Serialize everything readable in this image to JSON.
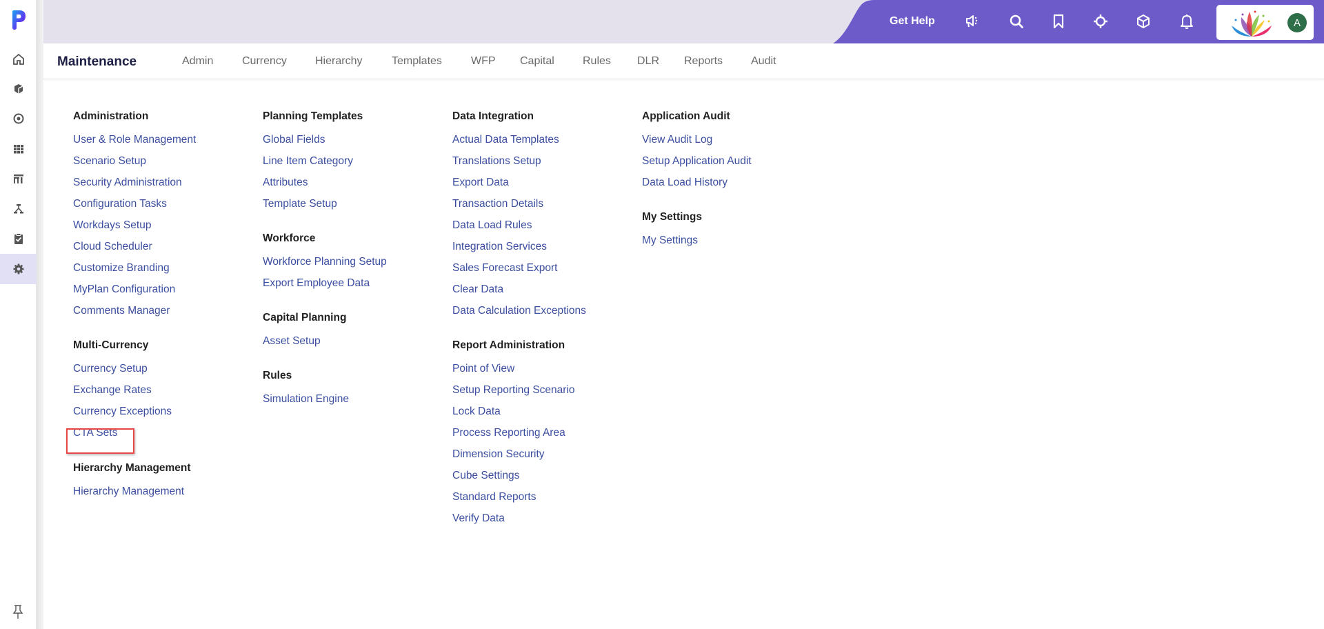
{
  "sidebar": {
    "logo": "planful-logo",
    "items": [
      {
        "name": "home",
        "icon": "home-icon",
        "active": false
      },
      {
        "name": "models",
        "icon": "cube-icon",
        "active": false
      },
      {
        "name": "dashboards",
        "icon": "target-icon",
        "active": false
      },
      {
        "name": "planning",
        "icon": "grid-icon",
        "active": false
      },
      {
        "name": "reports",
        "icon": "chart-icon",
        "active": false
      },
      {
        "name": "structure",
        "icon": "hierarchy-icon",
        "active": false
      },
      {
        "name": "tasks",
        "icon": "clipboard-check-icon",
        "active": false
      },
      {
        "name": "maintenance",
        "icon": "gear-icon",
        "active": true
      }
    ],
    "pin_icon": "pin-icon"
  },
  "topbar": {
    "get_help": "Get Help",
    "icons": [
      "megaphone-icon",
      "search-icon",
      "bookmark-icon",
      "crosshair-icon",
      "box-icon",
      "bell-icon"
    ],
    "avatar_initial": "A",
    "accent": "#6e5bca"
  },
  "menubar": {
    "title": "Maintenance",
    "tabs": [
      "Admin",
      "Currency",
      "Hierarchy",
      "Templates",
      "WFP",
      "Capital",
      "Rules",
      "DLR",
      "Reports",
      "Audit"
    ]
  },
  "columns": [
    {
      "sections": [
        {
          "title": "Administration",
          "links": [
            "User & Role Management",
            "Scenario Setup",
            "Security Administration",
            "Configuration Tasks",
            "Workdays Setup",
            "Cloud Scheduler",
            "Customize Branding",
            "MyPlan Configuration",
            "Comments Manager"
          ]
        },
        {
          "title": "Multi-Currency",
          "links": [
            "Currency Setup",
            "Exchange Rates",
            "Currency Exceptions",
            "CTA Sets"
          ]
        },
        {
          "title": "Hierarchy Management",
          "links": [
            "Hierarchy Management"
          ]
        }
      ]
    },
    {
      "sections": [
        {
          "title": "Planning Templates",
          "links": [
            "Global Fields",
            "Line Item Category",
            "Attributes",
            "Template Setup"
          ]
        },
        {
          "title": "Workforce",
          "links": [
            "Workforce Planning Setup",
            "Export Employee Data"
          ]
        },
        {
          "title": "Capital Planning",
          "links": [
            "Asset Setup"
          ]
        },
        {
          "title": "Rules",
          "links": [
            "Simulation Engine"
          ]
        }
      ]
    },
    {
      "sections": [
        {
          "title": "Data Integration",
          "links": [
            "Actual Data Templates",
            "Translations Setup",
            "Export Data",
            "Transaction Details",
            "Data Load Rules",
            "Integration Services",
            "Sales Forecast Export",
            "Clear Data",
            "Data Calculation Exceptions"
          ]
        },
        {
          "title": "Report Administration",
          "links": [
            "Point of View",
            "Setup Reporting Scenario",
            "Lock Data",
            "Process Reporting Area",
            "Dimension Security",
            "Cube Settings",
            "Standard Reports",
            "Verify Data"
          ]
        }
      ]
    },
    {
      "sections": [
        {
          "title": "Application Audit",
          "links": [
            "View Audit Log",
            "Setup Application Audit",
            "Data Load History"
          ]
        },
        {
          "title": "My Settings",
          "links": [
            "My Settings"
          ]
        }
      ]
    }
  ],
  "highlighted_link": "CTA Sets",
  "highlight_color": "#e84545"
}
